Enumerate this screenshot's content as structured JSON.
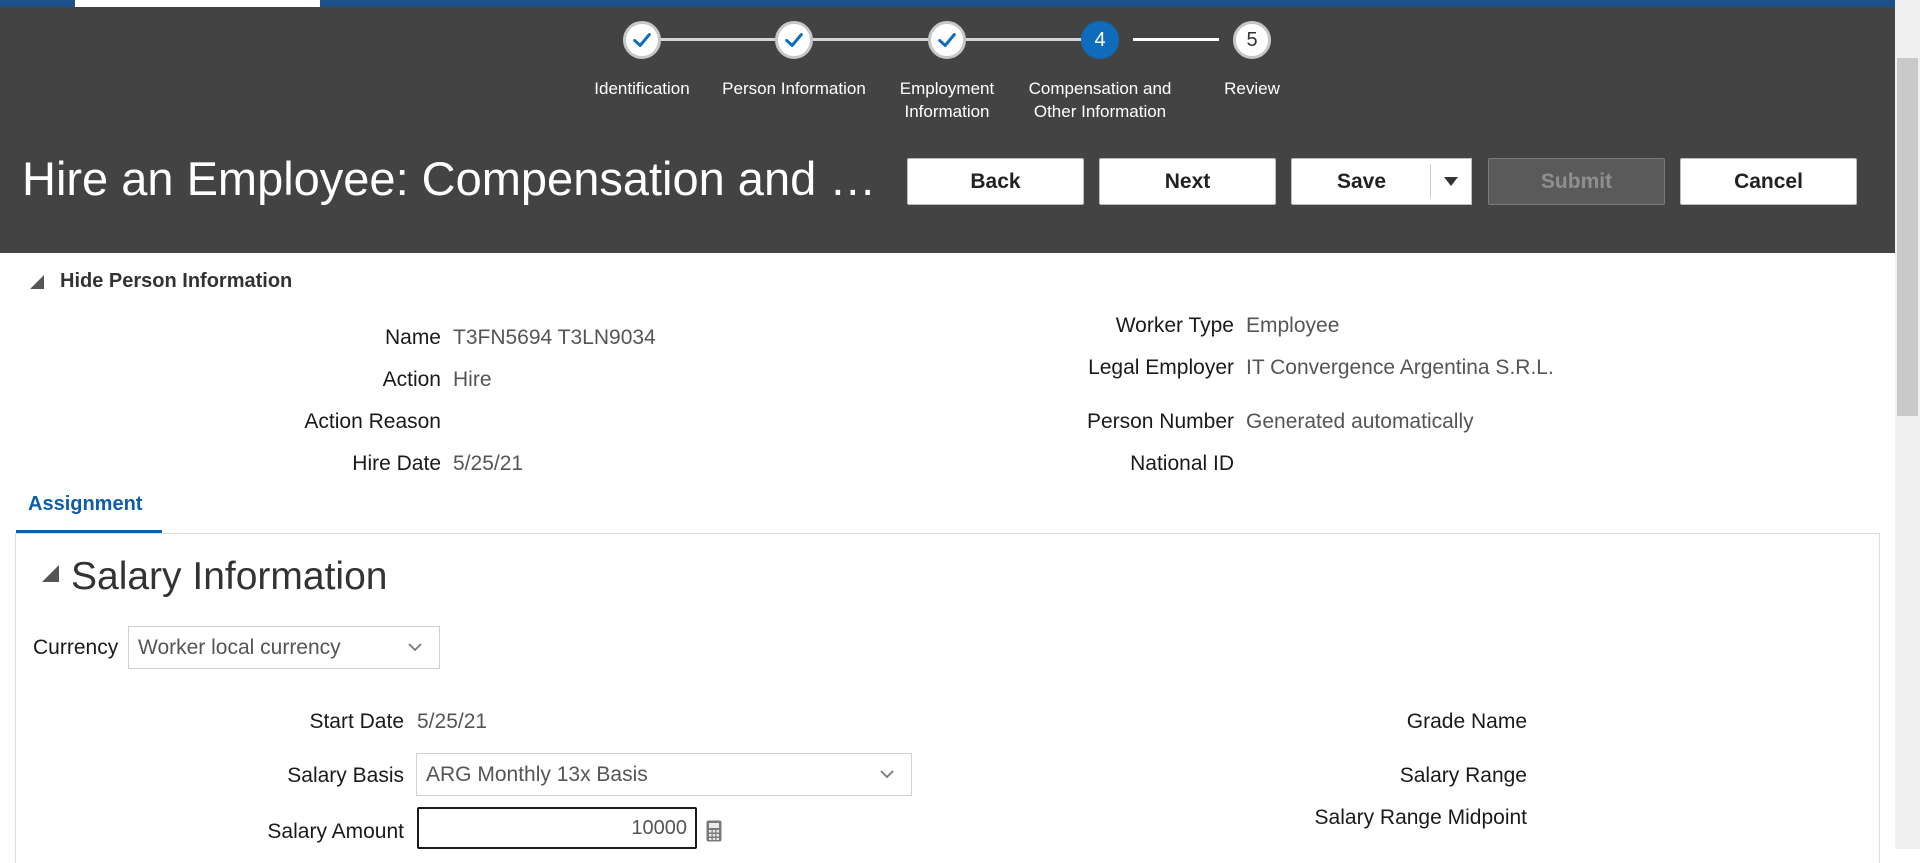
{
  "header": {
    "title": "Hire an Employee: Compensation and Other Information",
    "buttons": {
      "back": "Back",
      "next": "Next",
      "save": "Save",
      "submit": "Submit",
      "cancel": "Cancel"
    }
  },
  "train": [
    {
      "label": "Identification",
      "state": "done",
      "icon": "check-icon"
    },
    {
      "label": "Person Information",
      "state": "done",
      "icon": "check-icon"
    },
    {
      "label": "Employment Information",
      "state": "done",
      "icon": "check-icon"
    },
    {
      "number": "4",
      "label": "Compensation and Other Information",
      "state": "current"
    },
    {
      "number": "5",
      "label": "Review",
      "state": "next"
    }
  ],
  "person_info": {
    "toggle_label": "Hide Person Information",
    "left": [
      {
        "label": "Name",
        "value": "T3FN5694 T3LN9034"
      },
      {
        "label": "Action",
        "value": "Hire"
      },
      {
        "label": "Action Reason",
        "value": ""
      },
      {
        "label": "Hire Date",
        "value": "5/25/21"
      }
    ],
    "right": [
      {
        "label": "Worker Type",
        "value": "Employee"
      },
      {
        "label": "Legal Employer",
        "value": "IT Convergence Argentina S.R.L."
      },
      {
        "label": "Person Number",
        "value": "Generated automatically"
      },
      {
        "label": "National ID",
        "value": ""
      }
    ]
  },
  "tabs": [
    {
      "label": "Assignment",
      "active": true
    }
  ],
  "salary": {
    "section_title": "Salary Information",
    "currency_label": "Currency",
    "currency_value": "Worker local currency",
    "start_date_label": "Start Date",
    "start_date_value": "5/25/21",
    "salary_basis_label": "Salary Basis",
    "salary_basis_value": "ARG Monthly 13x Basis",
    "salary_amount_label": "Salary Amount",
    "salary_amount_value": "10000",
    "grade_name_label": "Grade Name",
    "salary_range_label": "Salary Range",
    "salary_range_midpoint_label": "Salary Range Midpoint"
  },
  "colors": {
    "header_bg": "#434343",
    "accent": "#0f6cbd",
    "link": "#0f5ca8"
  }
}
